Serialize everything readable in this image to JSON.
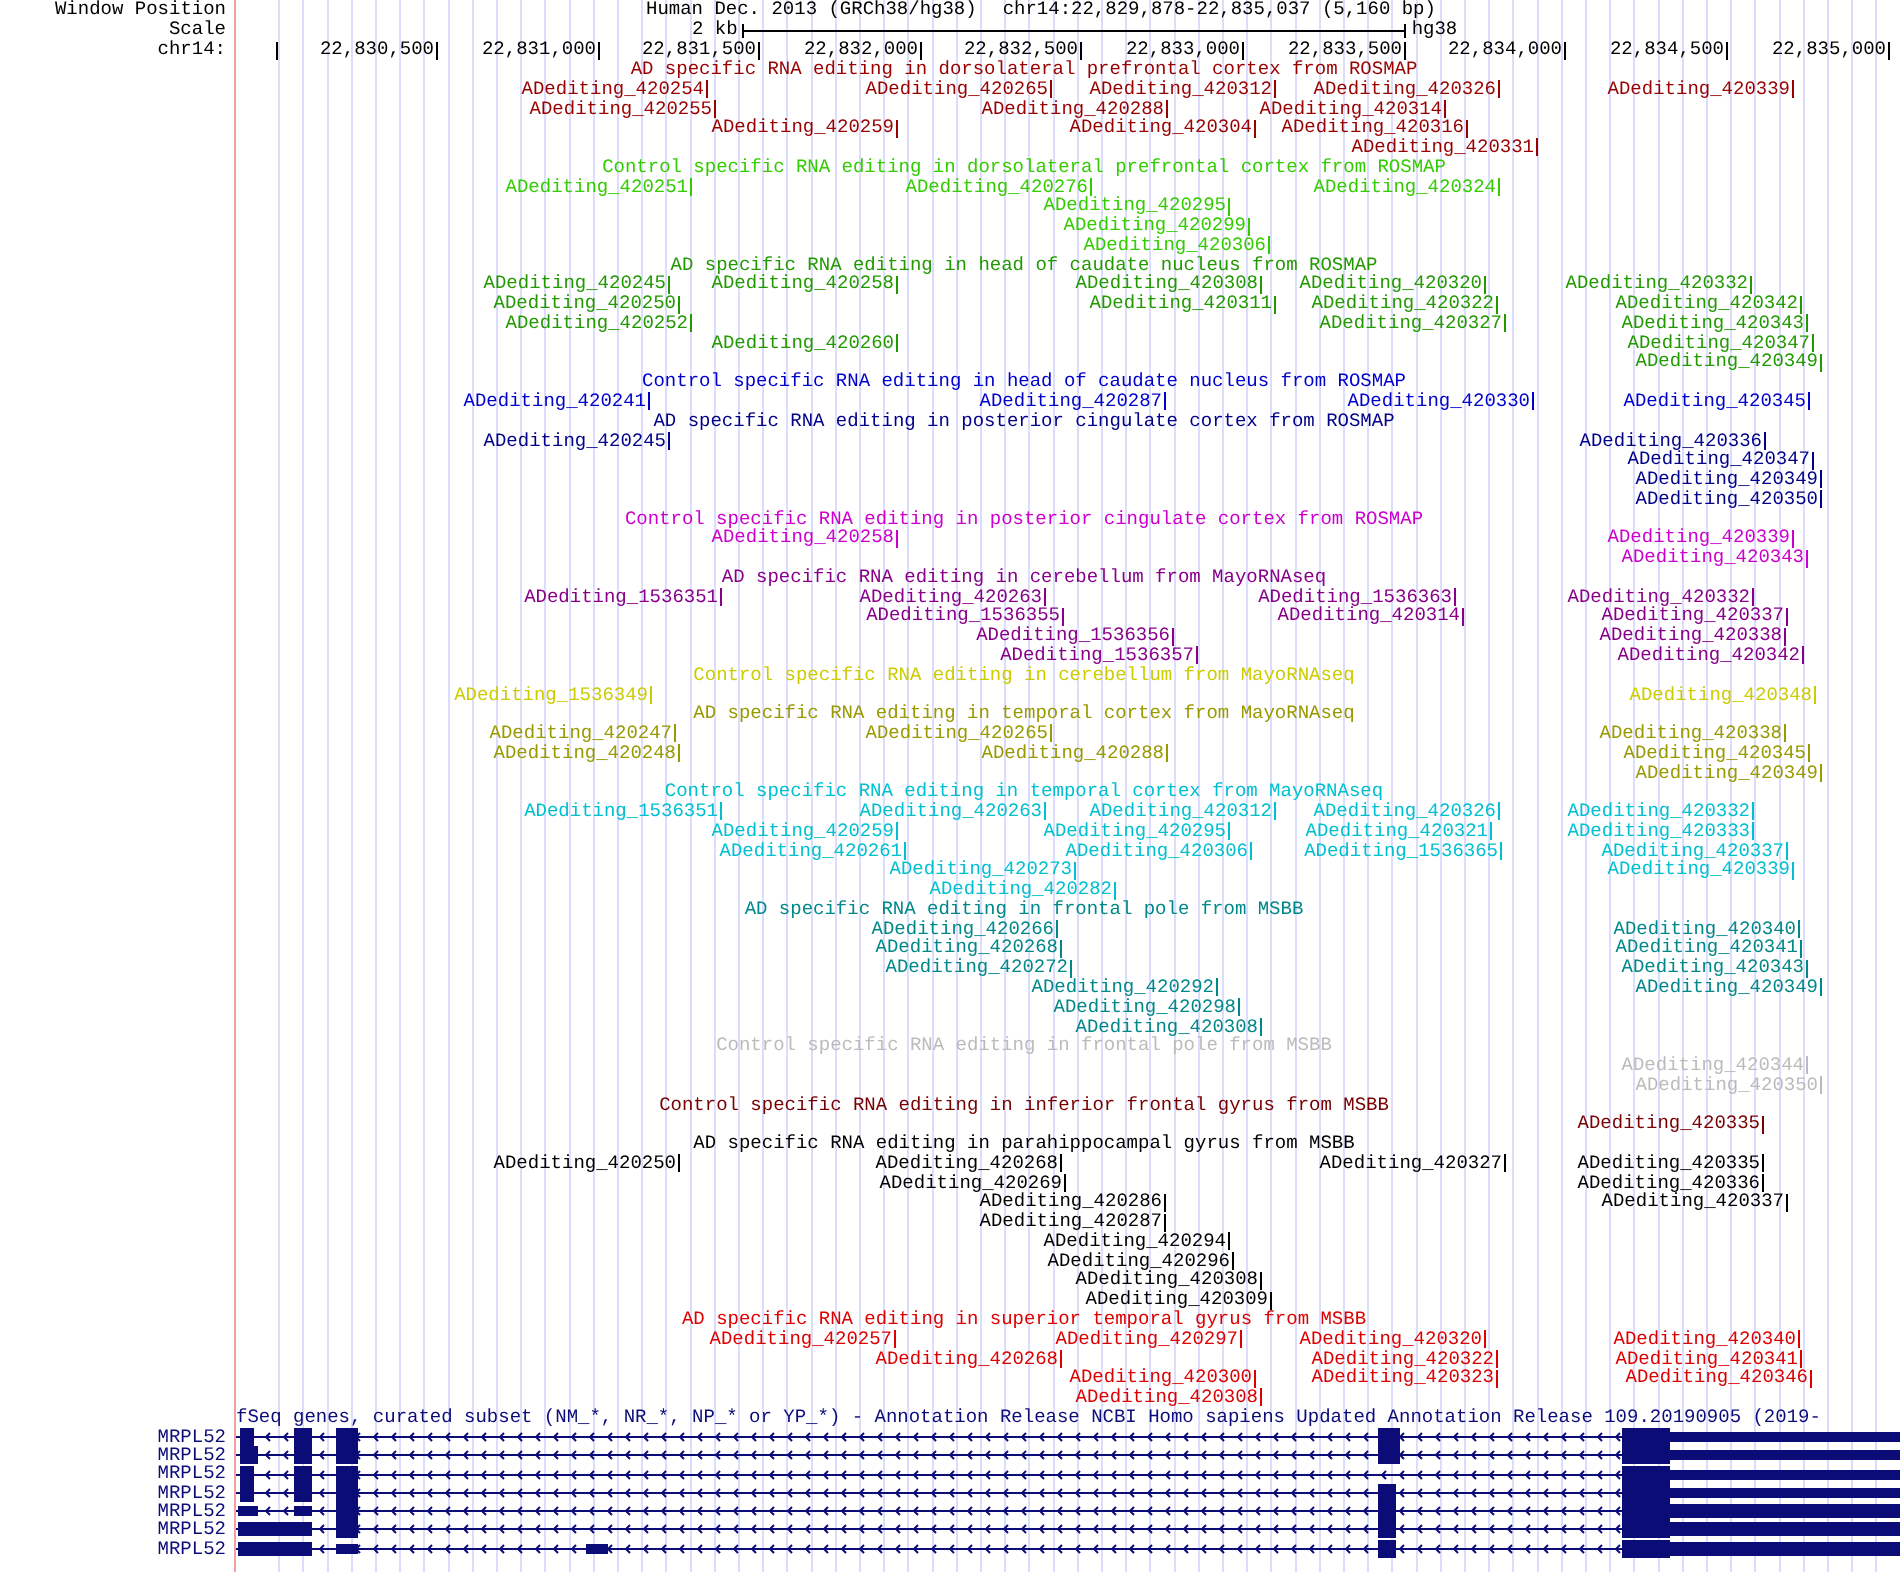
{
  "header": {
    "window_position_label": "Window Position",
    "assembly": "Human Dec. 2013 (GRCh38/hg38)",
    "position": "chr14:22,829,878-22,835,037 (5,160 bp)",
    "scale_label": "Scale",
    "scale_length": "2 kb",
    "scale_assembly": "hg38"
  },
  "ruler": {
    "chromosome": "chr14:",
    "ticks": [
      "22,830,500",
      "22,831,000",
      "22,831,500",
      "22,832,000",
      "22,832,500",
      "22,833,000",
      "22,833,500",
      "22,834,000",
      "22,834,500",
      "22,835,000"
    ]
  },
  "tracks": [
    {
      "title": "AD specific RNA editing in dorsolateral prefrontal cortex from ROSMAP",
      "color": "#990000",
      "features": [
        "ADediting_420254",
        "ADediting_420265",
        "ADediting_420312",
        "ADediting_420326",
        "ADediting_420339",
        "ADediting_420255",
        "ADediting_420288",
        "ADediting_420314",
        "ADediting_420259",
        "ADediting_420304",
        "ADediting_420316",
        "ADediting_420331"
      ]
    },
    {
      "title": "Control specific RNA editing in dorsolateral prefrontal cortex from ROSMAP",
      "color": "#33cc00",
      "features": [
        "ADediting_420251",
        "ADediting_420276",
        "ADediting_420324",
        "ADediting_420295",
        "ADediting_420299",
        "ADediting_420306"
      ]
    },
    {
      "title": "AD specific RNA editing in head of caudate nucleus from ROSMAP",
      "color": "#229900",
      "features": [
        "ADediting_420245",
        "ADediting_420258",
        "ADediting_420308",
        "ADediting_420320",
        "ADediting_420332",
        "ADediting_420250",
        "ADediting_420311",
        "ADediting_420322",
        "ADediting_420342",
        "ADediting_420252",
        "ADediting_420327",
        "ADediting_420343",
        "ADediting_420260",
        "ADediting_420347",
        "ADediting_420349"
      ]
    },
    {
      "title": "Control specific RNA editing in head of caudate nucleus from ROSMAP",
      "color": "#0000cc",
      "features": [
        "ADediting_420241",
        "ADediting_420287",
        "ADediting_420330",
        "ADediting_420345"
      ]
    },
    {
      "title": "AD specific RNA editing in posterior cingulate cortex from ROSMAP",
      "color": "#000088",
      "features": [
        "ADediting_420245",
        "ADediting_420336",
        "ADediting_420347",
        "ADediting_420349",
        "ADediting_420350"
      ]
    },
    {
      "title": "Control specific RNA editing in posterior cingulate cortex from ROSMAP",
      "color": "#cc00cc",
      "features": [
        "ADediting_420258",
        "ADediting_420339",
        "ADediting_420343"
      ]
    },
    {
      "title": "AD specific RNA editing in cerebellum from MayoRNAseq",
      "color": "#880088",
      "features": [
        "ADediting_1536351",
        "ADediting_420263",
        "ADediting_1536363",
        "ADediting_420332",
        "ADediting_1536355",
        "ADediting_420314",
        "ADediting_420337",
        "ADediting_1536356",
        "ADediting_420338",
        "ADediting_1536357",
        "ADediting_420342"
      ]
    },
    {
      "title": "Control specific RNA editing in cerebellum from MayoRNAseq",
      "color": "#cccc00",
      "features": [
        "ADediting_1536349",
        "ADediting_420348"
      ]
    },
    {
      "title": "AD specific RNA editing in temporal cortex from MayoRNAseq",
      "color": "#999900",
      "features": [
        "ADediting_420247",
        "ADediting_420265",
        "ADediting_420338",
        "ADediting_420248",
        "ADediting_420288",
        "ADediting_420345",
        "ADediting_420349"
      ]
    },
    {
      "title": "Control specific RNA editing in temporal cortex from MayoRNAseq",
      "color": "#00c0d0",
      "features": [
        "ADediting_1536351",
        "ADediting_420263",
        "ADediting_420312",
        "ADediting_420326",
        "ADediting_420332",
        "ADediting_420259",
        "ADediting_420295",
        "ADediting_420321",
        "ADediting_420333",
        "ADediting_420261",
        "ADediting_420306",
        "ADediting_1536365",
        "ADediting_420337",
        "ADediting_420273",
        "ADediting_420339",
        "ADediting_420282"
      ]
    },
    {
      "title": "AD specific RNA editing in frontal pole from MSBB",
      "color": "#008888",
      "features": [
        "ADediting_420266",
        "ADediting_420340",
        "ADediting_420268",
        "ADediting_420341",
        "ADediting_420272",
        "ADediting_420343",
        "ADediting_420292",
        "ADediting_420349",
        "ADediting_420298",
        "ADediting_420308"
      ]
    },
    {
      "title": "Control specific RNA editing in frontal pole from MSBB",
      "color": "#bbbbbb",
      "features": [
        "ADediting_420344",
        "ADediting_420350"
      ]
    },
    {
      "title": "Control specific RNA editing in inferior frontal gyrus from MSBB",
      "color": "#770000",
      "features": [
        "ADediting_420335"
      ]
    },
    {
      "title": "AD specific RNA editing in parahippocampal gyrus from MSBB",
      "color": "#000000",
      "features": [
        "ADediting_420250",
        "ADediting_420268",
        "ADediting_420327",
        "ADediting_420335",
        "ADediting_420269",
        "ADediting_420336",
        "ADediting_420286",
        "ADediting_420337",
        "ADediting_420287",
        "ADediting_420294",
        "ADediting_420296",
        "ADediting_420308",
        "ADediting_420309"
      ]
    },
    {
      "title": "AD specific RNA editing in superior temporal gyrus from MSBB",
      "color": "#dd0000",
      "features": [
        "ADediting_420257",
        "ADediting_420297",
        "ADediting_420320",
        "ADediting_420340",
        "ADediting_420268",
        "ADediting_420322",
        "ADediting_420341",
        "ADediting_420300",
        "ADediting_420323",
        "ADediting_420346",
        "ADediting_420308"
      ]
    }
  ],
  "refseq": {
    "title": "fSeq genes, curated subset (NM_*, NR_*, NP_* or YP_*) - Annotation Release NCBI Homo sapiens Updated Annotation Release 109.20190905 (2019-",
    "color": "#0c0c78",
    "genes": [
      "MRPL52",
      "MRPL52",
      "MRPL52",
      "MRPL52",
      "MRPL52",
      "MRPL52",
      "MRPL52"
    ]
  }
}
